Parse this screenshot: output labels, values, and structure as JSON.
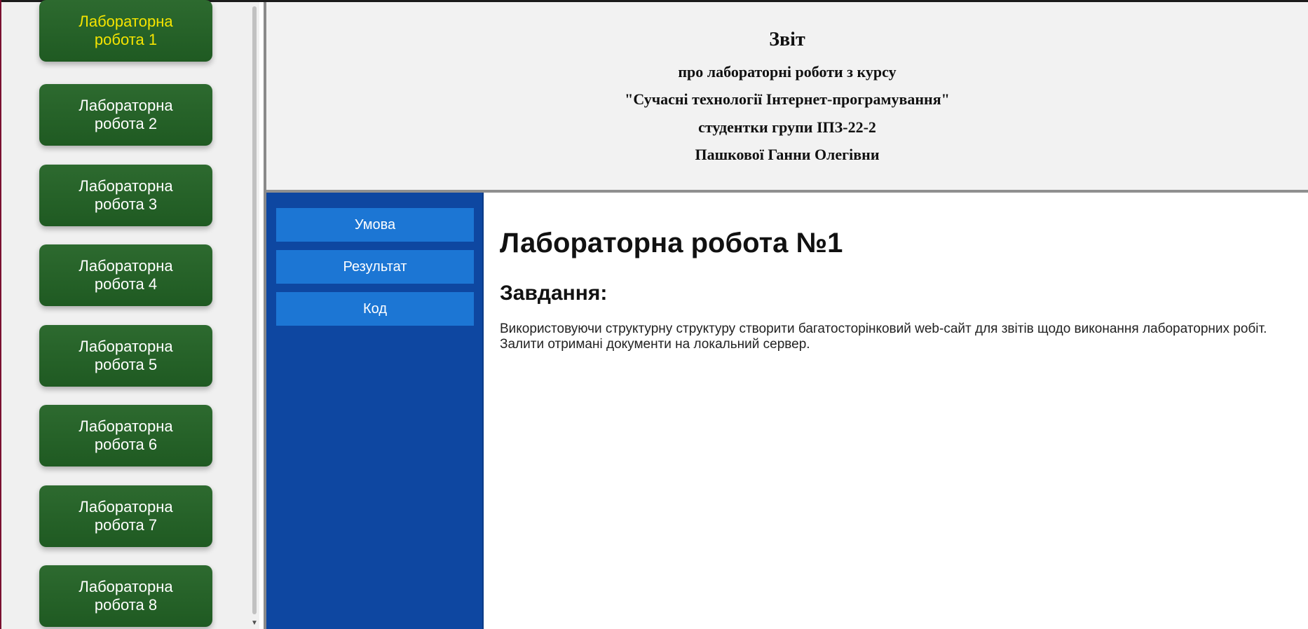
{
  "lab_nav": {
    "items": [
      {
        "label": "Лабораторна робота 1",
        "active": true
      },
      {
        "label": "Лабораторна робота 2",
        "active": false
      },
      {
        "label": "Лабораторна робота 3",
        "active": false
      },
      {
        "label": "Лабораторна робота 4",
        "active": false
      },
      {
        "label": "Лабораторна робота 5",
        "active": false
      },
      {
        "label": "Лабораторна робота 6",
        "active": false
      },
      {
        "label": "Лабораторна робота 7",
        "active": false
      },
      {
        "label": "Лабораторна робота 8",
        "active": false
      }
    ]
  },
  "header": {
    "title": "Звіт",
    "line1": "про лабораторні роботи з курсу",
    "line2": "\"Сучасні технології Інтернет-програмування\"",
    "line3": "студентки групи ІПЗ-22-2",
    "line4": "Пашкової Ганни Олегівни"
  },
  "sub_nav": {
    "items": [
      {
        "label": "Умова"
      },
      {
        "label": "Результат"
      },
      {
        "label": "Код"
      }
    ]
  },
  "content": {
    "title": "Лабораторна робота №1",
    "subtitle": "Завдання:",
    "text": "Використовуючи структурну структуру створити багатосторінковий web-сайт для звітів щодо виконання лабораторних робіт. Залити отримані документи на локальний сервер."
  },
  "colors": {
    "lab_button": "#2d6a2f",
    "lab_active_text": "#f5e400",
    "sub_nav_bg": "#0e47a1",
    "sub_button": "#1c76d4",
    "header_bg": "#f2f2f2"
  },
  "icons": {
    "scroll_down": "chevron-down-icon"
  }
}
